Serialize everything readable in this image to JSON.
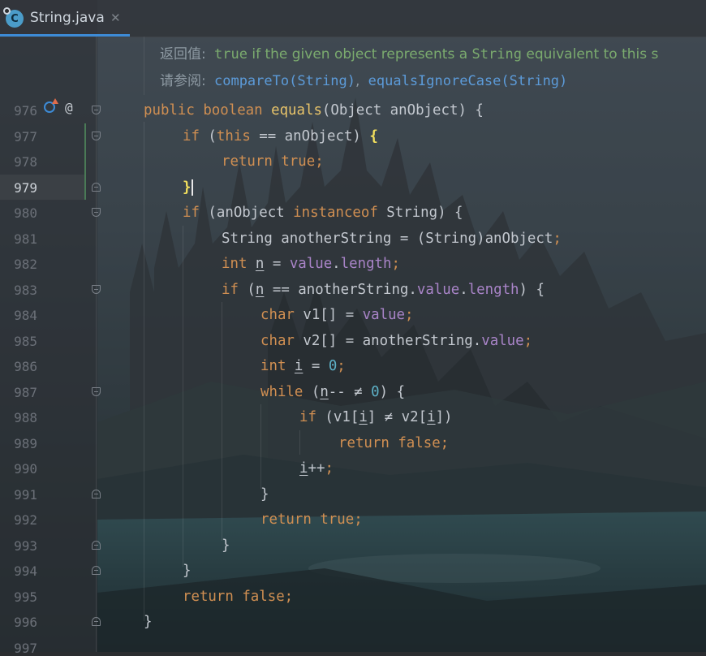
{
  "tab": {
    "label": "String.java",
    "close": "✕",
    "icon_letter": "C"
  },
  "doc": {
    "returns_label": "返回值:",
    "returns_code1": "true",
    "returns_text": " if the given object represents a ",
    "returns_code2": "String",
    "returns_text2": " equivalent to this s",
    "see_label": "请参阅:",
    "see_link1": "compareTo(String)",
    "see_sep": ",",
    "see_link2": "equalsIgnoreCase(String)"
  },
  "gutter": {
    "at_symbol": "@",
    "line_numbers": [
      "976",
      "977",
      "978",
      "979",
      "980",
      "981",
      "982",
      "983",
      "984",
      "985",
      "986",
      "987",
      "988",
      "989",
      "990",
      "991",
      "992",
      "993",
      "994",
      "995",
      "996",
      "997"
    ]
  },
  "code": {
    "l976": [
      "public",
      "boolean",
      "equals",
      "(Object anObject) {"
    ],
    "l977": [
      "if",
      " (",
      "this",
      " == anObject) ",
      "{"
    ],
    "l978": [
      "return",
      "true",
      ";"
    ],
    "l979": [
      "}"
    ],
    "l980": [
      "if",
      " (anObject ",
      "instanceof",
      " String) {"
    ],
    "l981": [
      "String anotherString = (String)anObject",
      ";"
    ],
    "l982": [
      "int",
      "n",
      " = ",
      "value",
      ".",
      "length",
      ";"
    ],
    "l983": [
      "if",
      " (",
      "n",
      " == anotherString.",
      "value",
      ".",
      "length",
      ") {"
    ],
    "l984": [
      "char",
      " v1[] = ",
      "value",
      ";"
    ],
    "l985": [
      "char",
      " v2[] = anotherString.",
      "value",
      ";"
    ],
    "l986": [
      "int",
      "i",
      " = ",
      "0",
      ";"
    ],
    "l987": [
      "while",
      " (",
      "n",
      "-- ≠ ",
      "0",
      ") {"
    ],
    "l988": [
      "if",
      " (v1[",
      "i",
      "] ≠ v2[",
      "i",
      "])"
    ],
    "l989": [
      "return",
      "false",
      ";"
    ],
    "l990": [
      "i",
      "++",
      ";"
    ],
    "l991": [
      "}"
    ],
    "l992": [
      "return",
      "true",
      ";"
    ],
    "l993": [
      "}"
    ],
    "l994": [
      "}"
    ],
    "l995": [
      "return",
      "false",
      ";"
    ],
    "l996": [
      "}"
    ]
  }
}
